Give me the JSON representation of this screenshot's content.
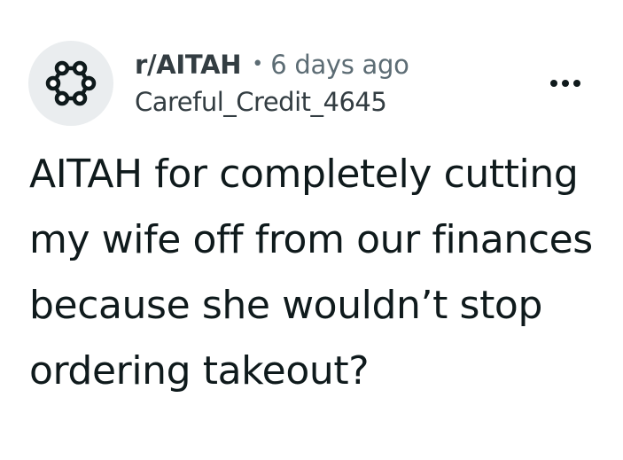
{
  "post": {
    "subreddit": "r/AITAH",
    "separator": "•",
    "time_ago": "6 days ago",
    "author": "Careful_Credit_4645",
    "title": "AITAH for completely cutting my wife off from our finances because she wouldn’t stop ordering takeout?",
    "avatar_icon": "community-network-icon",
    "more_icon": "more-options-icon"
  },
  "colors": {
    "text_primary": "#0f1a1c",
    "text_secondary": "#5c6c74",
    "avatar_bg": "#eaedef"
  }
}
